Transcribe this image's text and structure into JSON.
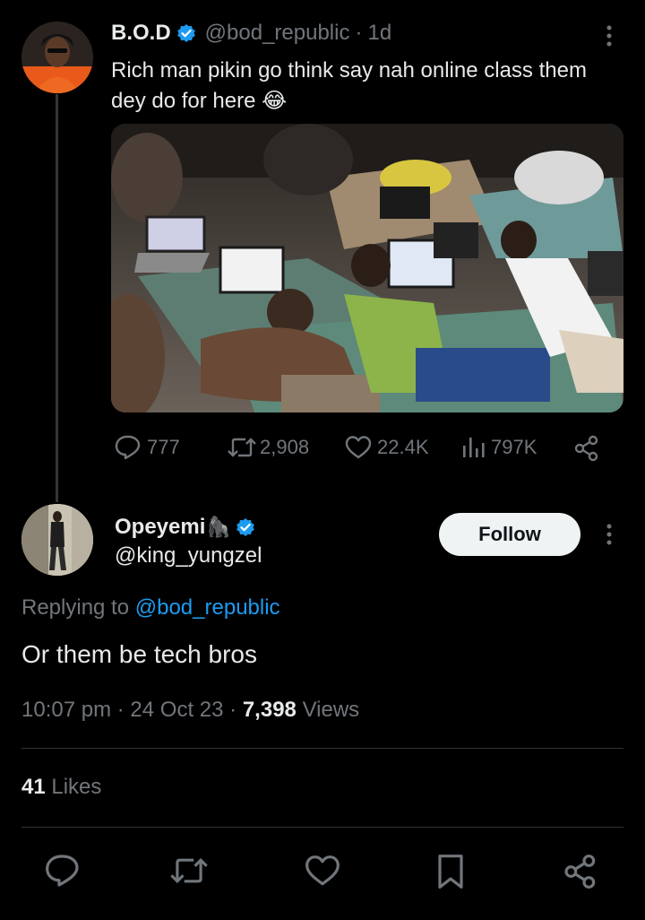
{
  "colors": {
    "background": "#000000",
    "text": "#e7e9ea",
    "muted": "#71767b",
    "accent": "#1d9bf0",
    "verified": "#1d9bf0"
  },
  "parent_tweet": {
    "display_name": "B.O.D",
    "handle": "@bod_republic",
    "separator": "·",
    "time": "1d",
    "text_line1": "Rich man pikin go think say nah online class them",
    "text_line2": "dey do for here",
    "emoji": "😂",
    "image_alt": "Young men lying on mats on the floor using laptops",
    "stats": {
      "replies": "777",
      "reposts": "2,908",
      "likes": "22.4K",
      "views": "797K"
    },
    "icons": [
      "verified-badge-icon",
      "more-icon",
      "reply-icon",
      "repost-icon",
      "like-icon",
      "views-icon",
      "share-icon"
    ]
  },
  "reply_tweet": {
    "display_name": "Opeyemi",
    "name_emoji": "🦍",
    "handle": "@king_yungzel",
    "follow_label": "Follow",
    "replying_prefix": "Replying to",
    "replying_to": "@bod_republic",
    "text": "Or them be tech bros",
    "time": "10:07 pm",
    "date": "24 Oct 23",
    "views_count": "7,398",
    "views_label": "Views",
    "likes_count": "41",
    "likes_label": "Likes"
  },
  "action_bar": {
    "icons": [
      "reply-icon",
      "repost-icon",
      "like-icon",
      "bookmark-icon",
      "share-icon"
    ]
  }
}
